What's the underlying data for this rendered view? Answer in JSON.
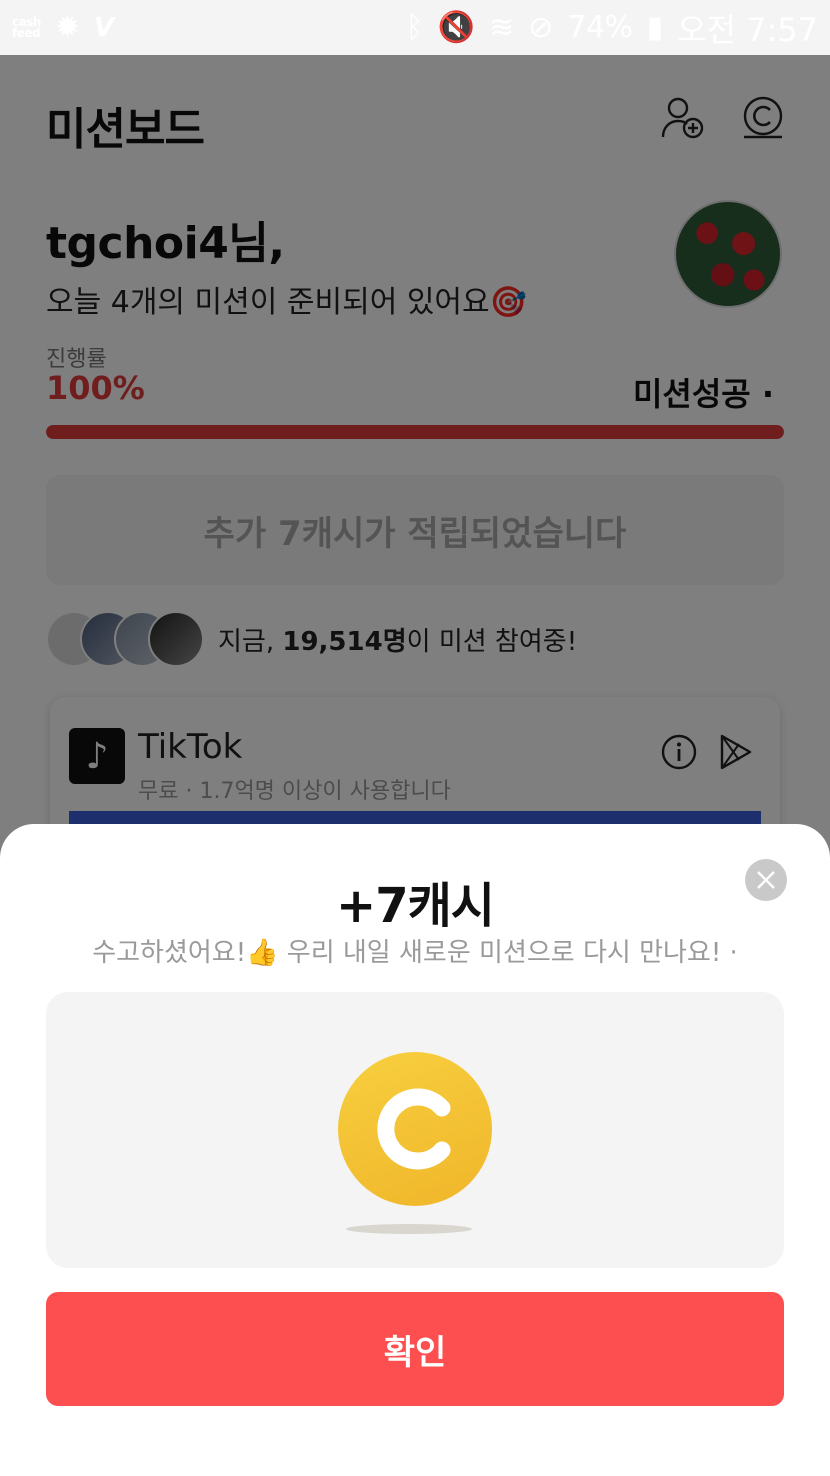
{
  "status_bar": {
    "cashfeed_label": "cash feed",
    "battery": "74%",
    "time": "오전 7:57"
  },
  "header": {
    "title": "미션보드",
    "icons": [
      "add-user-icon",
      "cash-coin-icon"
    ]
  },
  "greeting": {
    "name": "tgchoi4님,",
    "subtitle": "오늘 4개의 미션이 준비되어 있어요🎯"
  },
  "progress": {
    "label": "진행률",
    "value_text": "100%",
    "fraction": 1.0,
    "status": "미션성공 ·"
  },
  "reward_banner": "추가 7캐시가 적립되었습니다",
  "participants": {
    "prefix": "지금, ",
    "count": "19,514명",
    "suffix": "이 미션 참여중!"
  },
  "app_card": {
    "name": "TikTok",
    "subtitle": "무료 · 1.7억명 이상이 사용합니다"
  },
  "sheet": {
    "title": "+7캐시",
    "subtitle": "수고하셨어요!👍 우리 내일 새로운 미션으로 다시 만나요! ·",
    "confirm_label": "확인"
  },
  "colors": {
    "accent": "#fd4f4f",
    "progress": "#e03a3a",
    "coin": "#f4c233"
  }
}
